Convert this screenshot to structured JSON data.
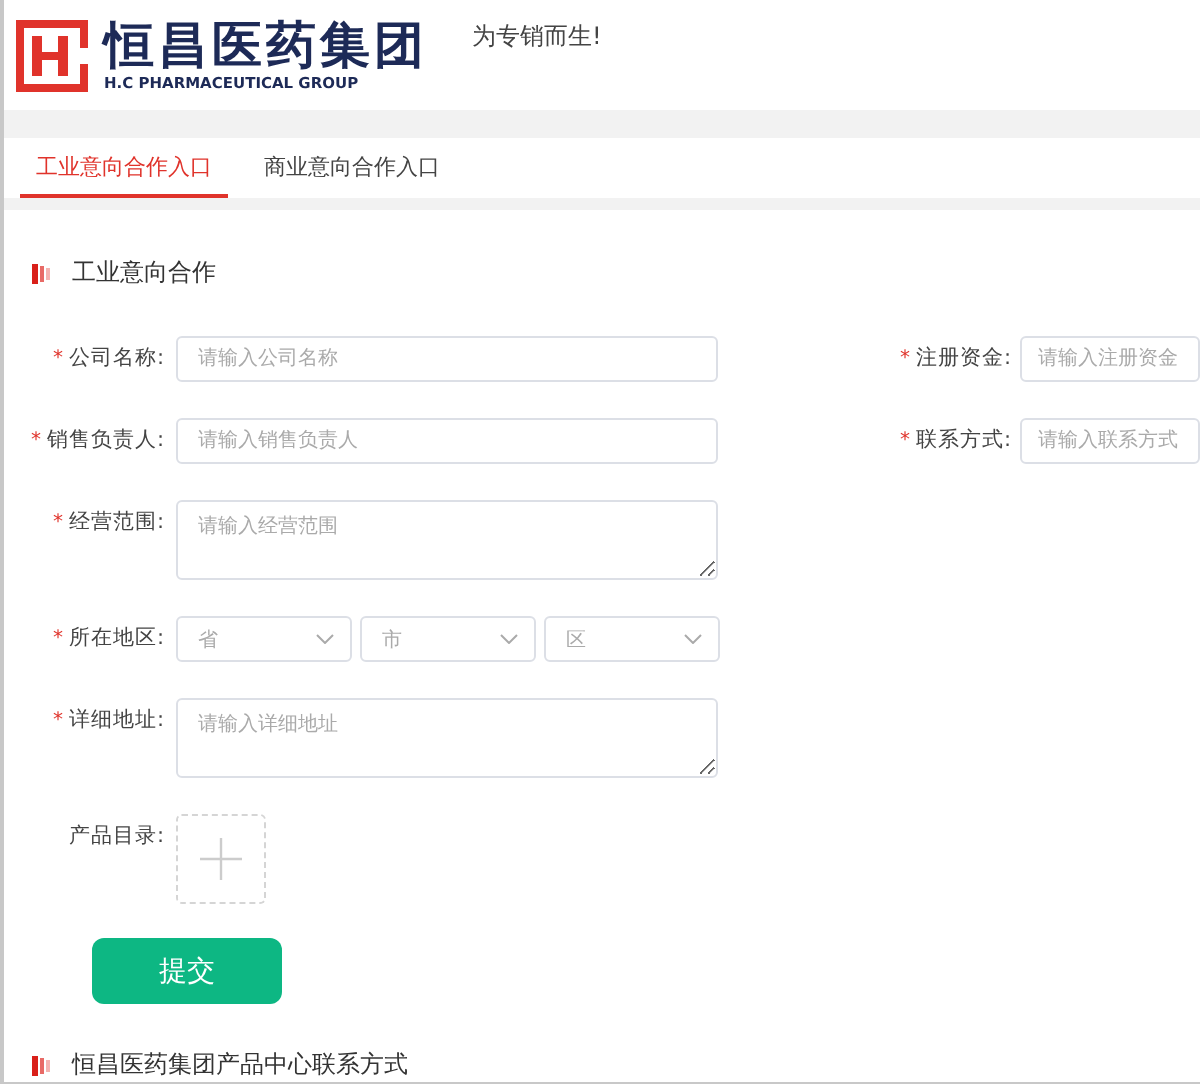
{
  "header": {
    "brand_cn": "恒昌医药集团",
    "brand_en": "H.C PHARMACEUTICAL GROUP",
    "slogan": "为专销而生!"
  },
  "tabs": [
    {
      "label": "工业意向合作入口",
      "selected": true
    },
    {
      "label": "商业意向合作入口",
      "selected": false
    }
  ],
  "section_title": "工业意向合作",
  "rows": [
    {
      "fields": [
        {
          "kind": "input",
          "mark": "*",
          "label": "公司名称:",
          "placeholder": "请输入公司名称"
        },
        {
          "kind": "input",
          "mark": "*",
          "label": "注册资金:",
          "placeholder": "请输入注册资金"
        }
      ]
    },
    {
      "fields": [
        {
          "kind": "input",
          "mark": "*",
          "label": "销售负责人:",
          "placeholder": "请输入销售负责人"
        },
        {
          "kind": "input",
          "mark": "*",
          "label": "联系方式:",
          "placeholder": "请输入联系方式"
        }
      ]
    },
    {
      "fields": [
        {
          "kind": "textarea",
          "mark": "*",
          "label": "经营范围:",
          "placeholder": "请输入经营范围"
        }
      ]
    },
    {
      "fields": [
        {
          "kind": "selects",
          "mark": "*",
          "label": "所在地区:",
          "options": [
            "省",
            "市",
            "区"
          ]
        }
      ]
    },
    {
      "fields": [
        {
          "kind": "textarea",
          "mark": "*",
          "label": "详细地址:",
          "placeholder": "请输入详细地址"
        }
      ]
    },
    {
      "fields": [
        {
          "kind": "upload",
          "label": "产品目录:"
        }
      ]
    }
  ],
  "submit": "提交",
  "next_section_title": "恒昌医药集团产品中心联系方式"
}
